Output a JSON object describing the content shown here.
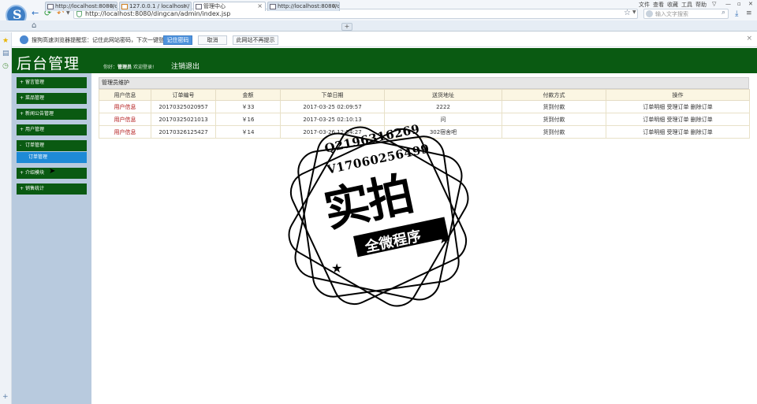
{
  "browser": {
    "menu": [
      "文件",
      "查看",
      "收藏",
      "工具",
      "帮助"
    ],
    "address": "http://localhost:8080/dingcan/admin/index.jsp",
    "search_placeholder": "输入文字搜索",
    "tabs": [
      {
        "label": "http://localhost:8080/c",
        "active": false
      },
      {
        "label": "127.0.0.1 / localhost /",
        "active": false
      },
      {
        "label": "管理中心",
        "active": true
      },
      {
        "label": "http://localhost:8080/c",
        "active": false
      }
    ],
    "new_tab": "+",
    "password_prompt": {
      "message": "搜狗高速浏览器提醒您：记住此网站密码，下次一键登录！",
      "remember": "记住密码",
      "cancel": "取消",
      "never": "此网站不再提示"
    }
  },
  "header": {
    "title": "后台管理",
    "greeting_prefix": "你好：",
    "username": "管理员",
    "greeting_suffix": "欢迎登录!",
    "logout": "注销退出"
  },
  "sidebar": {
    "items": [
      {
        "label": "留言管理",
        "icon": "+"
      },
      {
        "label": "菜品管理",
        "icon": "+"
      },
      {
        "label": "新闻公告管理",
        "icon": "+"
      },
      {
        "label": "用户管理",
        "icon": "+"
      },
      {
        "label": "订单管理",
        "icon": "-"
      },
      {
        "label": "介绍模块",
        "icon": "+"
      },
      {
        "label": "销售统计",
        "icon": "+"
      }
    ],
    "sub_item": "订单管理"
  },
  "panel": {
    "title": "管理员维护",
    "columns": [
      "用户信息",
      "订单编号",
      "金额",
      "下单日期",
      "送货地址",
      "付款方式",
      "操作"
    ],
    "rows": [
      [
        "用户信息",
        "20170325020957",
        "￥33",
        "2017-03-25 02:09:57",
        "2222",
        "货到付款",
        "订单明细 受理订单 删除订单"
      ],
      [
        "用户信息",
        "20170325021013",
        "￥16",
        "2017-03-25 02:10:13",
        "问",
        "货到付款",
        "订单明细 受理订单 删除订单"
      ],
      [
        "用户信息",
        "20170326125427",
        "￥14",
        "2017-03-26 12:54:27",
        "302宿舍吧",
        "货到付款",
        "订单明细 受理订单 删除订单"
      ]
    ]
  },
  "watermark": {
    "line1": "Q2196316269",
    "line2": "V17060256499",
    "big": "实拍",
    "ribbon": "全微程序"
  },
  "colors": {
    "header_green": "#0a5a12",
    "sidebar_bg": "#b8cade",
    "active_sub": "#1e8ad6",
    "link_red": "#b01010"
  }
}
